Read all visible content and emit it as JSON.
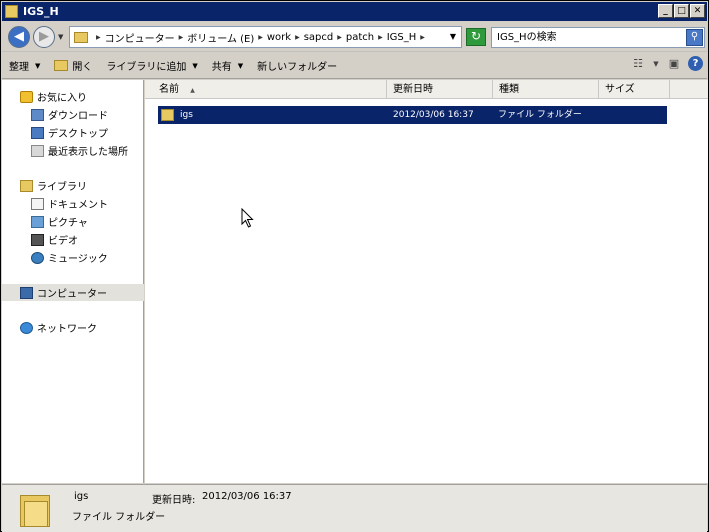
{
  "window": {
    "title": "IGS_H"
  },
  "title_buttons": {
    "minimize": "_",
    "maximize": "□",
    "close": "✕"
  },
  "address": {
    "crumbs": [
      "コンピューター",
      "ボリューム (E)",
      "work",
      "sapcd",
      "patch",
      "IGS_H"
    ]
  },
  "search": {
    "placeholder": "IGS_Hの検索"
  },
  "toolbar": {
    "organize": "整理",
    "open": "開く",
    "add_to_library": "ライブラリに追加",
    "share": "共有",
    "new_folder": "新しいフォルダー"
  },
  "nav": {
    "favorites": "お気に入り",
    "downloads": "ダウンロード",
    "desktop": "デスクトップ",
    "recent": "最近表示した場所",
    "libraries": "ライブラリ",
    "documents": "ドキュメント",
    "pictures": "ピクチャ",
    "videos": "ビデオ",
    "music": "ミュージック",
    "computer": "コンピューター",
    "network": "ネットワーク"
  },
  "columns": {
    "name": "名前",
    "modified": "更新日時",
    "type": "種類",
    "size": "サイズ"
  },
  "files": [
    {
      "name": "igs",
      "modified": "2012/03/06 16:37",
      "type": "ファイル フォルダー",
      "size": ""
    }
  ],
  "details": {
    "name": "igs",
    "date_label": "更新日時:",
    "date": "2012/03/06 16:37",
    "type": "ファイル フォルダー"
  },
  "icons": {
    "back": "back-arrow-icon",
    "forward": "forward-arrow-icon",
    "refresh": "refresh-icon",
    "search": "search-icon",
    "help": "help-icon"
  },
  "colors": {
    "title_bar": "#0a246a",
    "selection": "#0a246a",
    "chrome": "#d4d0c8"
  }
}
